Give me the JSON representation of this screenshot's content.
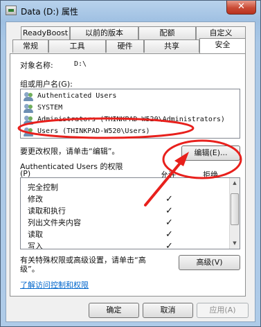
{
  "window": {
    "title": "Data (D:) 属性",
    "close_glyph": "✕"
  },
  "tabs_row1": [
    "ReadyBoost",
    "以前的版本",
    "配额",
    "自定义"
  ],
  "tabs_row2": [
    "常规",
    "工具",
    "硬件",
    "共享",
    "安全"
  ],
  "active_tab": "安全",
  "object": {
    "label": "对象名称:",
    "value": "D:\\"
  },
  "groups_label": "组或用户名(G):",
  "users": [
    "Authenticated Users",
    "SYSTEM",
    "Administrators (THINKPAD-W520\\Administrators)",
    "Users (THINKPAD-W520\\Users)"
  ],
  "change_perm_text": "要更改权限，请单击“编辑”。",
  "edit_button": "编辑(E)...",
  "perm_header": {
    "title": "Authenticated Users 的权限",
    "title_suffix": "(P)",
    "allow": "允许",
    "deny": "拒绝"
  },
  "permissions": [
    {
      "name": "完全控制",
      "allow": "",
      "deny": ""
    },
    {
      "name": "修改",
      "allow": "✓",
      "deny": ""
    },
    {
      "name": "读取和执行",
      "allow": "✓",
      "deny": ""
    },
    {
      "name": "列出文件夹内容",
      "allow": "✓",
      "deny": ""
    },
    {
      "name": "读取",
      "allow": "✓",
      "deny": ""
    },
    {
      "name": "写入",
      "allow": "✓",
      "deny": ""
    }
  ],
  "advanced_text_1": "有关特殊权限或高级设置，请单击“高",
  "advanced_text_2": "级”。",
  "advanced_button": "高级(V)",
  "link_text": "了解访问控制和权限",
  "footer": {
    "ok": "确定",
    "cancel": "取消",
    "apply": "应用(A)"
  },
  "colors": {
    "annotation": "#e8201c",
    "link": "#0066cc",
    "accent": "#6fae5b"
  },
  "icons": {
    "user": "users-group-icon",
    "drive": "drive-icon"
  }
}
